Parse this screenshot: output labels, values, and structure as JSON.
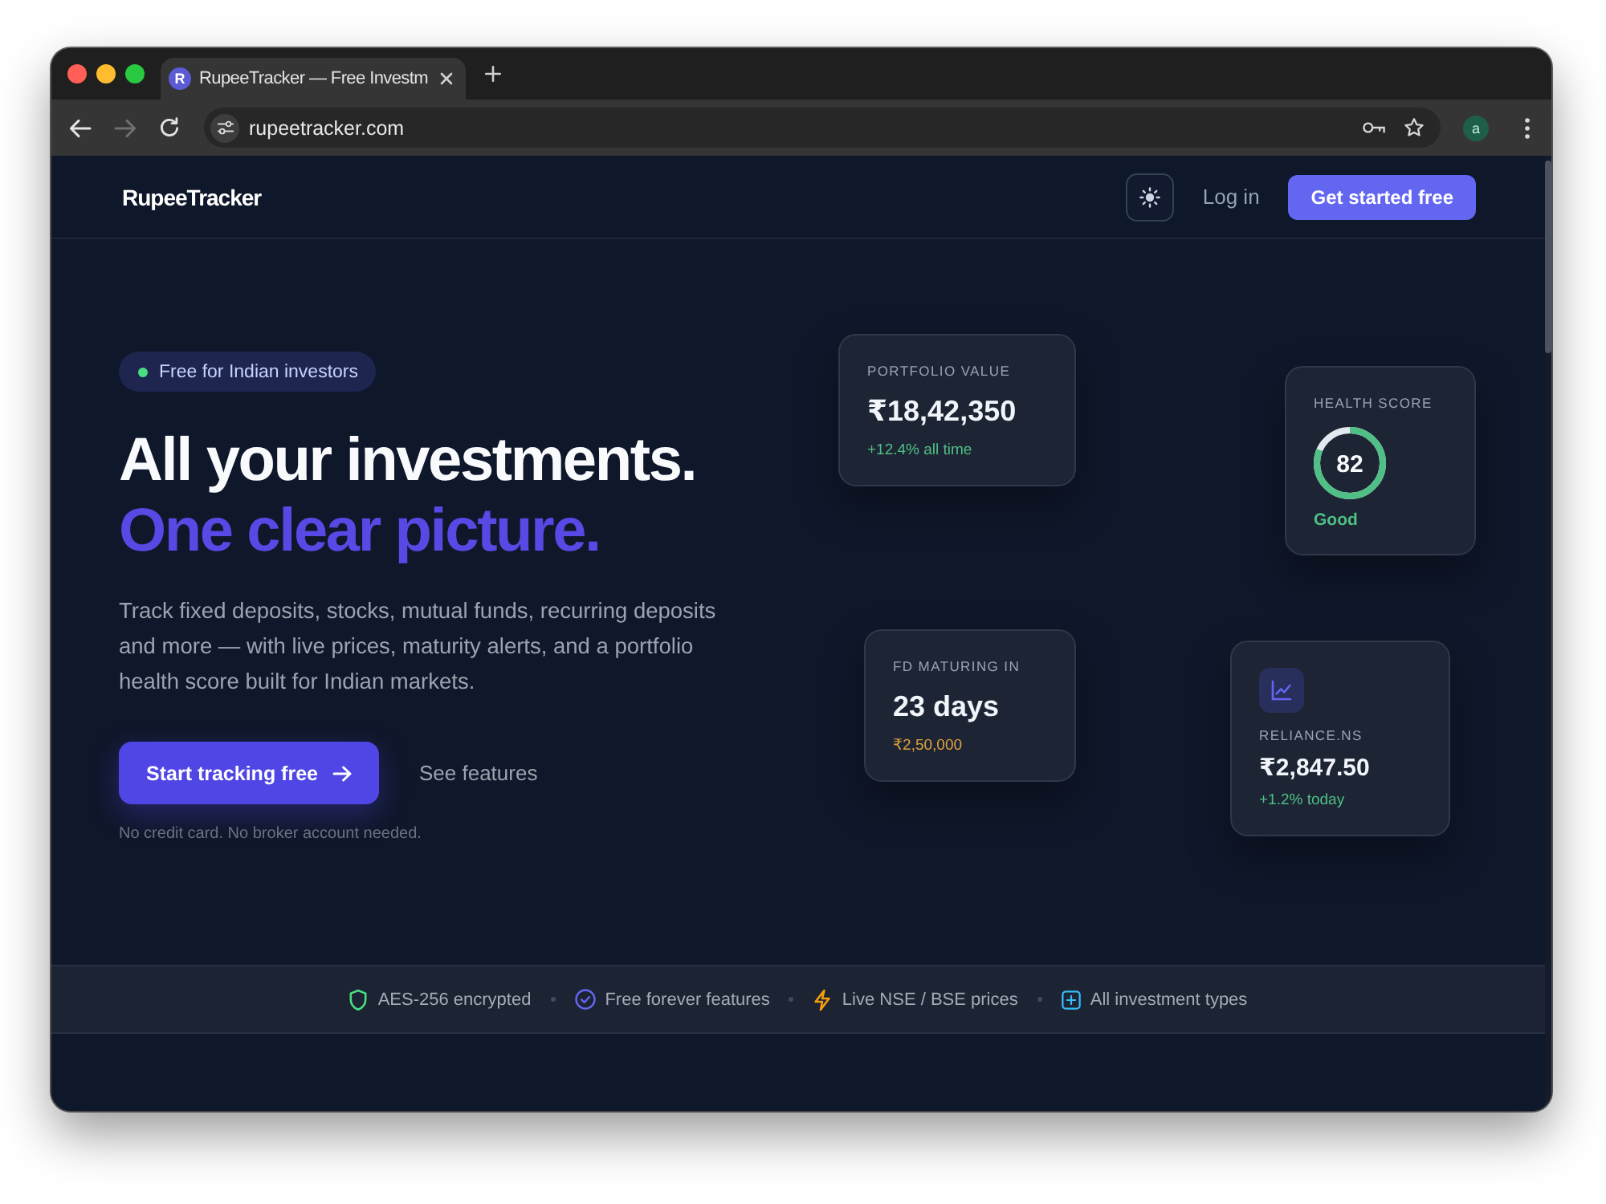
{
  "browser": {
    "tab": {
      "favicon": "R",
      "title": "RupeeTracker — Free Investm",
      "selected": true
    },
    "back_disabled": false,
    "forward_disabled": true,
    "url": "rupeetracker.com",
    "profile_initial": "a"
  },
  "nav": {
    "logo": "RupeeTracker",
    "login": "Log in",
    "cta": "Get started free"
  },
  "hero": {
    "badge": "Free for Indian investors",
    "headline": "All your investments.",
    "highlight": "One clear picture.",
    "description": "Track fixed deposits, stocks, mutual funds, recurring deposits and more — with live prices, maturity alerts, and a portfolio health score built for Indian markets.",
    "primary_button": "Start tracking free",
    "secondary_link": "See features",
    "note": "No credit card. No broker account needed."
  },
  "cards": [
    {
      "kind": "stat",
      "label": "PORTFOLIO VALUE",
      "value": "₹18,42,350",
      "change": "+12.4% all time",
      "color": "#4fbf85"
    },
    {
      "kind": "score",
      "label": "HEALTH SCORE",
      "value": "82",
      "level": 0.82,
      "rating": "Good",
      "color": "#4fbf85"
    },
    {
      "kind": "stat",
      "label": "FD MATURING IN",
      "value": "23 days",
      "change": "₹2,50,000",
      "color": "#e0a03c"
    },
    {
      "kind": "stock",
      "label": "RELIANCE.NS",
      "value": "₹2,847.50",
      "change": "+1.2% today",
      "color": "#4fbf85"
    }
  ],
  "trust_badges": [
    "AES-256 encrypted",
    "Free forever features",
    "Live NSE / BSE prices",
    "All investment types"
  ]
}
